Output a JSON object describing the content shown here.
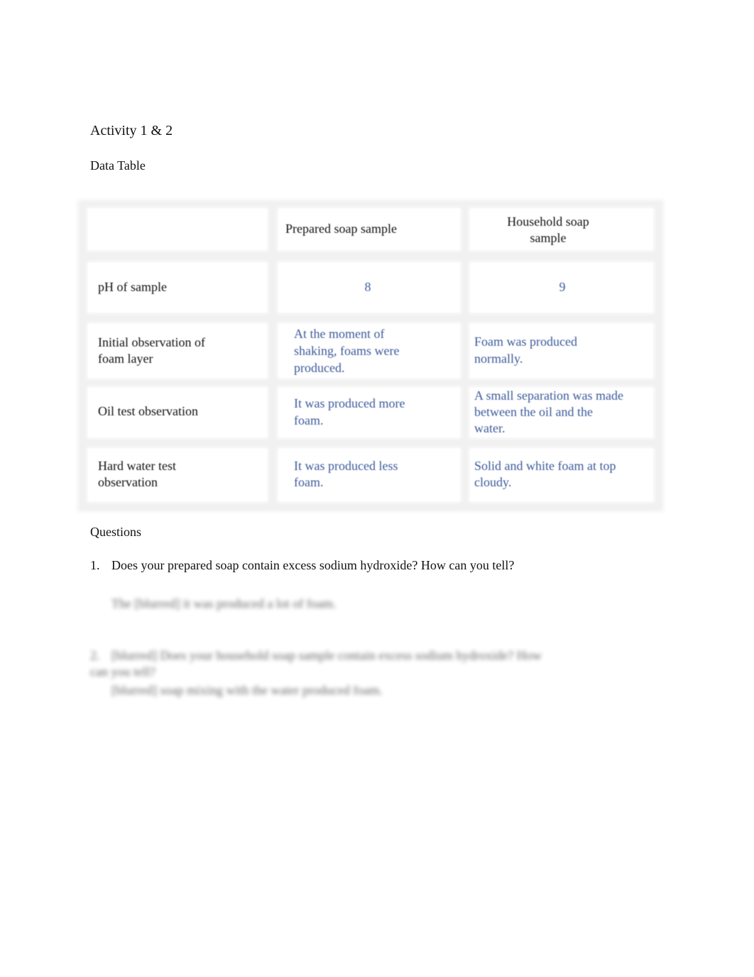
{
  "document": {
    "title": "Activity 1 & 2",
    "subtitle": "Data Table"
  },
  "table": {
    "headers": [
      "",
      "Prepared soap sample",
      "Household soap sample"
    ],
    "rows": [
      {
        "label": "pH of sample",
        "prepared": "8",
        "household": "9"
      },
      {
        "label": "Initial observation of foam layer",
        "prepared": "At the moment of shaking, foams were produced.",
        "household": "Foam was produced normally."
      },
      {
        "label": "Oil test observation",
        "prepared": "It was produced more foam.",
        "household": "A small separation was made between the oil and the water."
      },
      {
        "label": "Hard water test observation",
        "prepared": "It was produced less foam.",
        "household": "Solid and white foam at top cloudy."
      }
    ],
    "answer_color": "#3c5a9a"
  },
  "questions": {
    "heading": "Questions",
    "items": [
      {
        "number": "1.",
        "text": "Does your prepared soap contain excess sodium hydroxide? How can you tell?",
        "answer": "The [blurred] it was produced a lot of foam."
      },
      {
        "number": "2.",
        "text": "[blurred] Does your household soap sample contain excess sodium hydroxide? How can you tell?",
        "answer": "[blurred] soap mixing with the water produced foam."
      }
    ]
  }
}
